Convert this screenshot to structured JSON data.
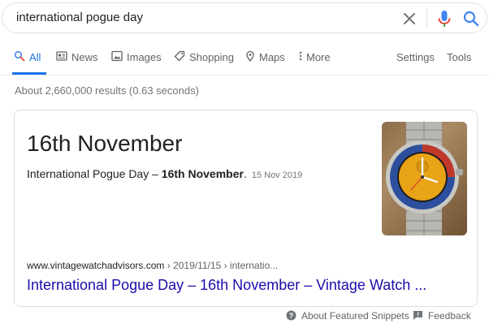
{
  "search": {
    "query": "international pogue day"
  },
  "tabs": [
    {
      "label": "All",
      "icon": "search-icon",
      "active": true
    },
    {
      "label": "News",
      "icon": "news-icon"
    },
    {
      "label": "Images",
      "icon": "image-icon"
    },
    {
      "label": "Shopping",
      "icon": "tag-icon"
    },
    {
      "label": "Maps",
      "icon": "map-pin-icon"
    },
    {
      "label": "More",
      "icon": "kebab-icon"
    }
  ],
  "tools": {
    "settings": "Settings",
    "tools": "Tools"
  },
  "result_stats": "About 2,660,000 results (0.63 seconds)",
  "featured_snippet": {
    "answer": "16th November",
    "snippet_prefix": "International Pogue Day – ",
    "snippet_bold": "16th November",
    "snippet_suffix": ".",
    "date": "15 Nov 2019",
    "cite_domain": "www.vintagewatchadvisors.com",
    "cite_path": " › 2019/11/15 › internatio...",
    "link_title": "International Pogue Day – 16th November – Vintage Watch ...",
    "image_subject": "watch-image"
  },
  "footer": {
    "about": "About Featured Snippets",
    "feedback": "Feedback"
  },
  "colors": {
    "accent": "#1a73e8",
    "link": "#1a0dab",
    "muted": "#70757a"
  }
}
